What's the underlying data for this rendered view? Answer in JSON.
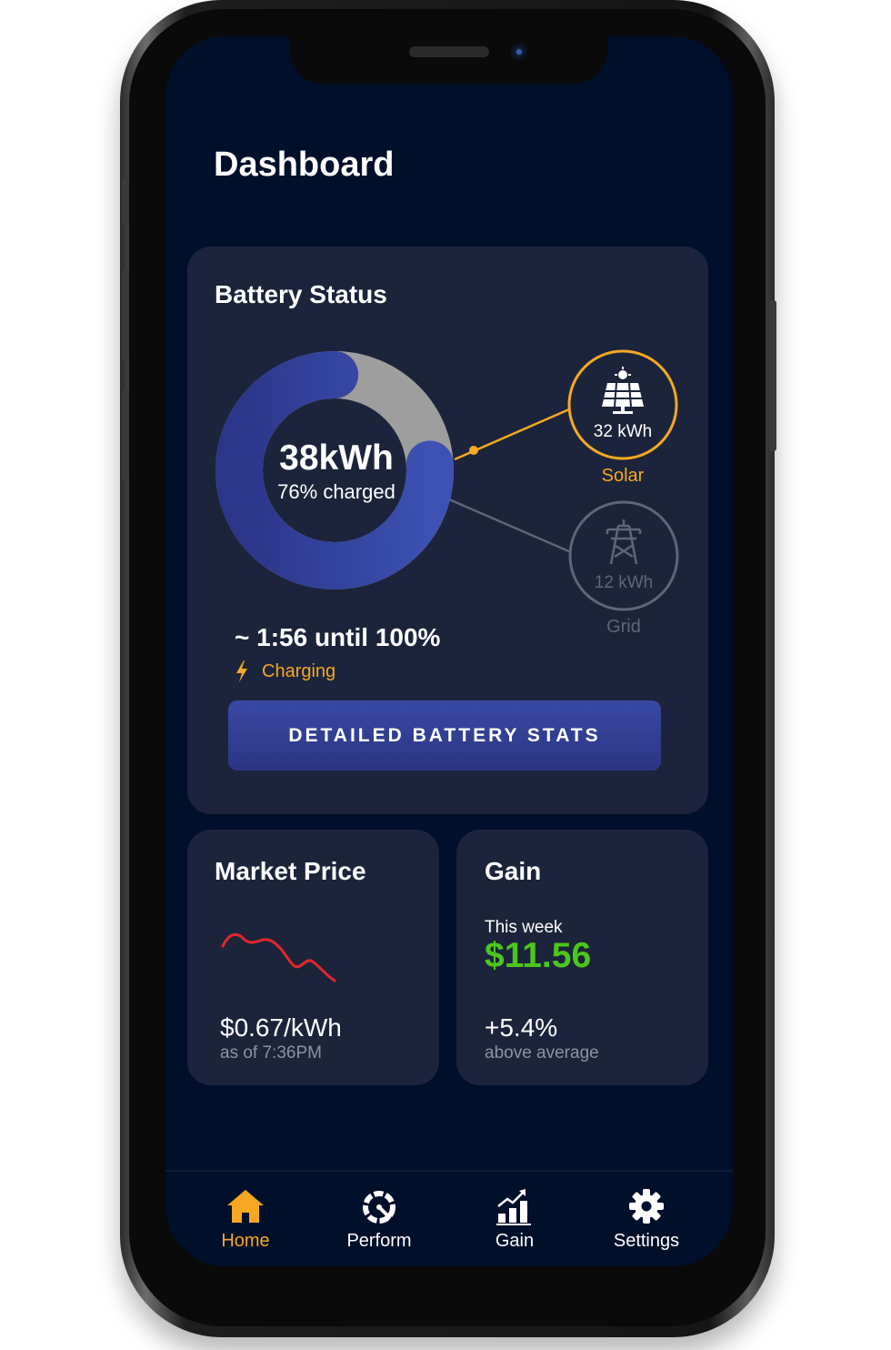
{
  "header": {
    "title": "Dashboard"
  },
  "battery": {
    "title": "Battery Status",
    "energy": "38kWh",
    "charged_label": "76% charged",
    "charge_fraction": 0.76,
    "eta": "~ 1:56 until 100%",
    "status": "Charging",
    "cta_label": "DETAILED BATTERY STATS",
    "sources": {
      "solar": {
        "label": "Solar",
        "value": "32 kWh",
        "icon": "solar-panel-icon",
        "color": "#f7a823"
      },
      "grid": {
        "label": "Grid",
        "value": "12 kWh",
        "icon": "power-tower-icon",
        "color": "#5f6678"
      }
    }
  },
  "market": {
    "title": "Market Price",
    "price": "$0.67/kWh",
    "as_of": "as of 7:36PM",
    "sparkline_color": "#e5262d"
  },
  "gain": {
    "title": "Gain",
    "period_label": "This week",
    "amount": "$11.56",
    "change": "+5.4%",
    "change_label": "above average",
    "amount_color": "#4cc61c"
  },
  "nav": {
    "items": [
      {
        "label": "Home",
        "icon": "home-icon",
        "active": true
      },
      {
        "label": "Perform",
        "icon": "speedometer-icon",
        "active": false
      },
      {
        "label": "Gain",
        "icon": "bar-chart-icon",
        "active": false
      },
      {
        "label": "Settings",
        "icon": "gear-icon",
        "active": false
      }
    ],
    "active_color": "#f7a823"
  },
  "colors": {
    "background": "#000f2a",
    "card": "#1b243a",
    "accent": "#f7a823",
    "primary": "#3949a3"
  }
}
